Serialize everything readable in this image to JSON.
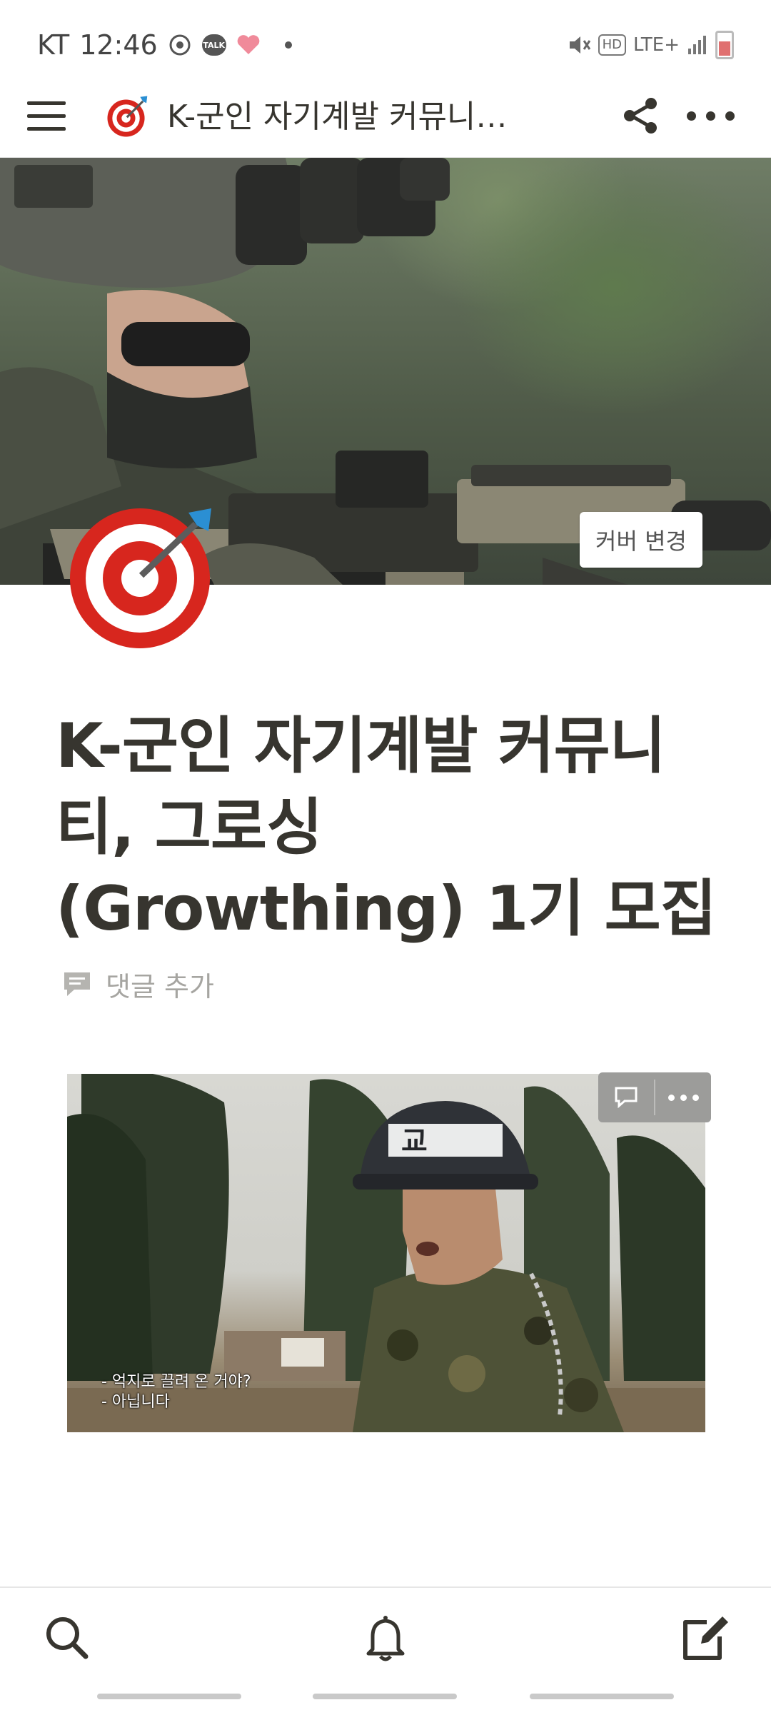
{
  "status_bar": {
    "carrier": "KT",
    "time": "12:46",
    "kakao_badge": "TALK",
    "hd_badge": "HD",
    "network": "LTE+"
  },
  "top_bar": {
    "title": "K-군인 자기계발 커뮤니티, 그로싱(Growthing) 1기 모집",
    "page_icon": "bullseye-dart-icon"
  },
  "cover": {
    "change_cover_label": "커버 변경"
  },
  "page": {
    "title": "K-군인 자기계발 커뮤니티, 그로싱(Growthing) 1기 모집",
    "add_comment_label": "댓글 추가"
  },
  "embed": {
    "subtitle_line1": "- 억지로 끌려 온 거야?",
    "subtitle_line2": "- 아닙니다",
    "helmet_text": "교"
  },
  "bottom_nav": {
    "items": [
      "search-icon",
      "bell-icon",
      "compose-icon"
    ]
  },
  "colors": {
    "text": "#37352f",
    "muted": "#a6a5a1",
    "target_red": "#d7261e"
  }
}
